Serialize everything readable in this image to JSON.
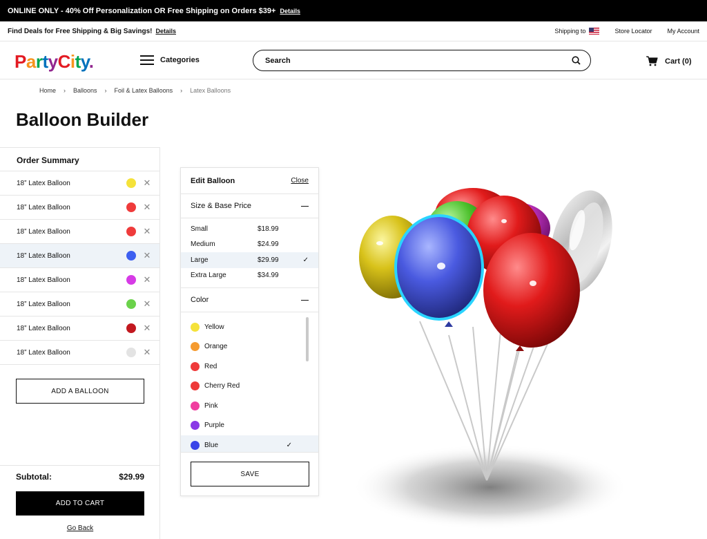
{
  "promo": {
    "text": "ONLINE ONLY - 40% Off Personalization OR Free Shipping on Orders $39+",
    "link": "Details"
  },
  "deals": {
    "text": "Find Deals for Free Shipping & Big Savings!",
    "link": "Details",
    "shipping_to": "Shipping to",
    "store_locator": "Store Locator",
    "my_account": "My Account"
  },
  "header": {
    "logo": [
      "P",
      "a",
      "r",
      "t",
      "y",
      "C",
      "i",
      "t",
      "y",
      "."
    ],
    "categories": "Categories",
    "search_placeholder": "Search",
    "cart": "Cart (0)"
  },
  "breadcrumb": [
    "Home",
    "Balloons",
    "Foil & Latex Balloons",
    "Latex Balloons"
  ],
  "page_title": "Balloon Builder",
  "order_summary": {
    "title": "Order Summary",
    "items": [
      {
        "label": "18” Latex Balloon",
        "color": "#f5e23a"
      },
      {
        "label": "18” Latex Balloon",
        "color": "#ef3b3b"
      },
      {
        "label": "18” Latex Balloon",
        "color": "#ef3b3b"
      },
      {
        "label": "18” Latex Balloon",
        "color": "#3d5ff0",
        "active": true
      },
      {
        "label": "18” Latex Balloon",
        "color": "#d63be6"
      },
      {
        "label": "18” Latex Balloon",
        "color": "#6bd24b"
      },
      {
        "label": "18” Latex Balloon",
        "color": "#c2181f"
      },
      {
        "label": "18” Latex Balloon",
        "color": "#e3e3e3"
      }
    ],
    "add_balloon": "ADD A BALLOON",
    "subtotal_label": "Subtotal:",
    "subtotal_value": "$29.99",
    "add_to_cart": "ADD TO CART",
    "go_back": "Go Back"
  },
  "edit_balloon": {
    "title": "Edit Balloon",
    "close": "Close",
    "size_section": "Size & Base Price",
    "sizes": [
      {
        "name": "Small",
        "price": "$18.99"
      },
      {
        "name": "Medium",
        "price": "$24.99"
      },
      {
        "name": "Large",
        "price": "$29.99",
        "selected": true
      },
      {
        "name": "Extra Large",
        "price": "$34.99"
      }
    ],
    "color_section": "Color",
    "colors": [
      {
        "name": "Yellow",
        "color": "#f5e23a"
      },
      {
        "name": "Orange",
        "color": "#f59b30"
      },
      {
        "name": "Red",
        "color": "#ef3b3b"
      },
      {
        "name": "Cherry Red",
        "color": "#ee3a3a"
      },
      {
        "name": "Pink",
        "color": "#f03ea0"
      },
      {
        "name": "Purple",
        "color": "#8a3ae6"
      },
      {
        "name": "Blue",
        "color": "#3a44e8",
        "selected": true
      }
    ],
    "save": "SAVE"
  }
}
